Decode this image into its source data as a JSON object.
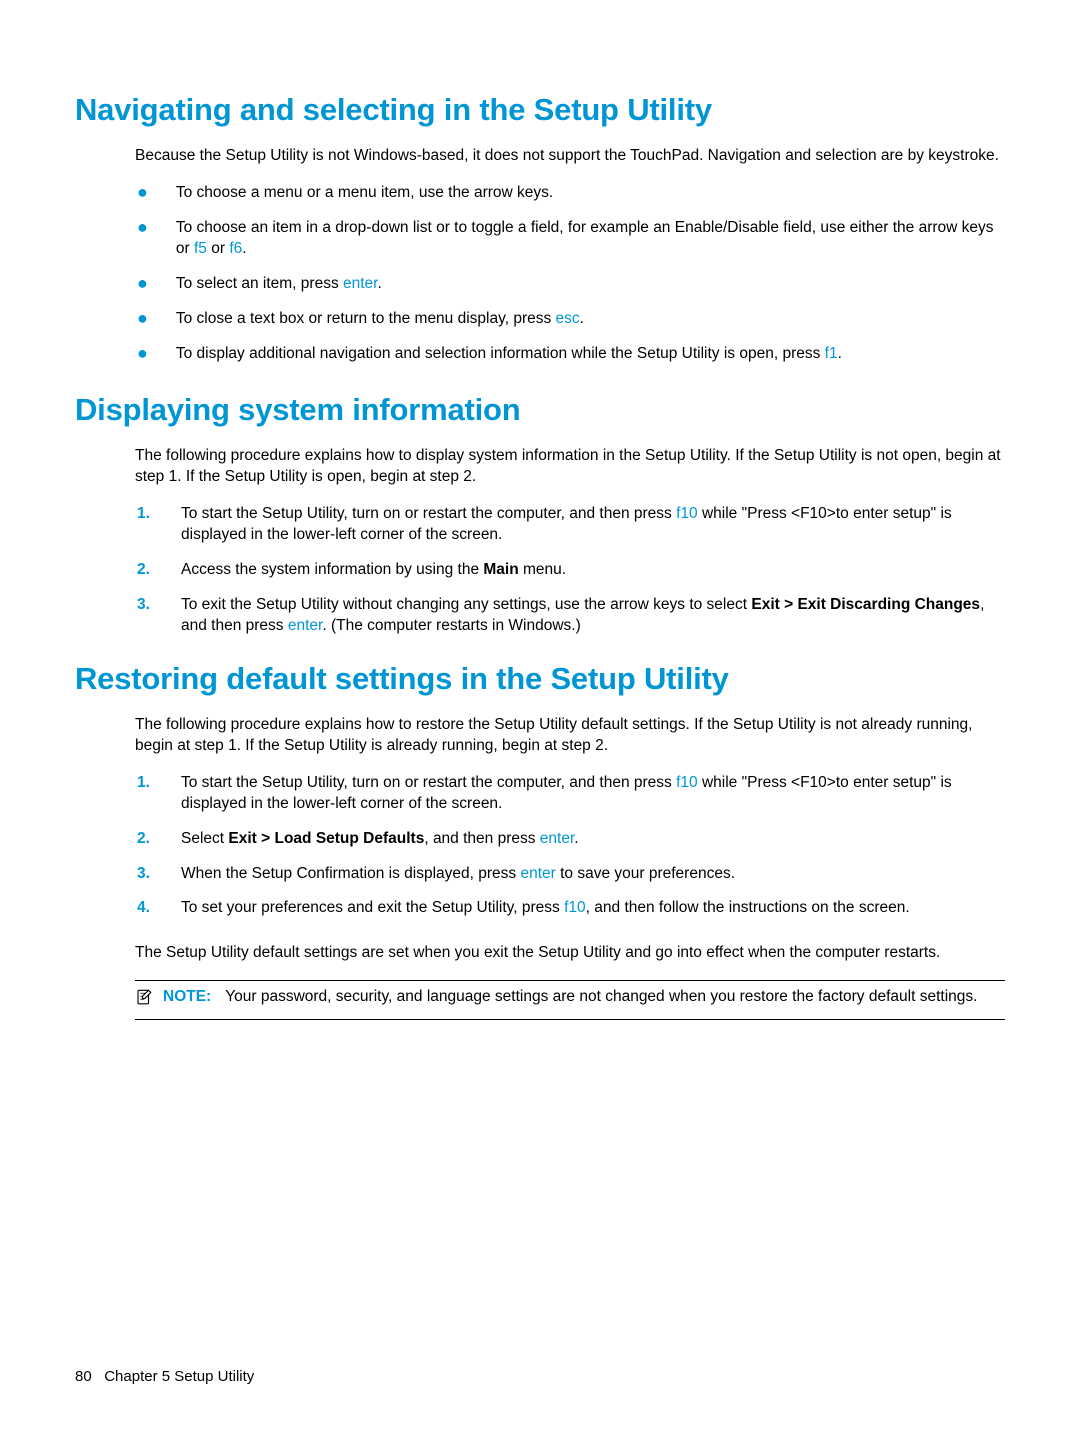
{
  "section1": {
    "heading": "Navigating and selecting in the Setup Utility",
    "intro": "Because the Setup Utility is not Windows-based, it does not support the TouchPad. Navigation and selection are by keystroke.",
    "bullets": {
      "b1": "To choose a menu or a menu item, use the arrow keys.",
      "b2_pre": "To choose an item in a drop-down list or to toggle a field, for example an Enable/Disable field, use either the arrow keys or ",
      "b2_k1": "f5",
      "b2_mid": " or ",
      "b2_k2": "f6",
      "b2_post": ".",
      "b3_pre": "To select an item, press ",
      "b3_k": "enter",
      "b3_post": ".",
      "b4_pre": "To close a text box or return to the menu display, press ",
      "b4_k": "esc",
      "b4_post": ".",
      "b5_pre": "To display additional navigation and selection information while the Setup Utility is open, press ",
      "b5_k": "f1",
      "b5_post": "."
    }
  },
  "section2": {
    "heading": "Displaying system information",
    "intro": "The following procedure explains how to display system information in the Setup Utility. If the Setup Utility is not open, begin at step 1. If the Setup Utility is open, begin at step 2.",
    "steps": {
      "n1": "1.",
      "s1_pre": "To start the Setup Utility, turn on or restart the computer, and then press ",
      "s1_k": "f10",
      "s1_post": " while \"Press <F10>to enter setup\" is displayed in the lower-left corner of the screen.",
      "n2": "2.",
      "s2_pre": "Access the system information by using the ",
      "s2_bold": "Main",
      "s2_post": " menu.",
      "n3": "3.",
      "s3_pre": "To exit the Setup Utility without changing any settings, use the arrow keys to select ",
      "s3_bold": "Exit > Exit Discarding Changes",
      "s3_mid": ", and then press ",
      "s3_k": "enter",
      "s3_post": ". (The computer restarts in Windows.)"
    }
  },
  "section3": {
    "heading": "Restoring default settings in the Setup Utility",
    "intro": "The following procedure explains how to restore the Setup Utility default settings. If the Setup Utility is not already running, begin at step 1. If the Setup Utility is already running, begin at step 2.",
    "steps": {
      "n1": "1.",
      "s1_pre": "To start the Setup Utility, turn on or restart the computer, and then press ",
      "s1_k": "f10",
      "s1_post": " while \"Press <F10>to enter setup\" is displayed in the lower-left corner of the screen.",
      "n2": "2.",
      "s2_pre": "Select ",
      "s2_bold": "Exit > Load Setup Defaults",
      "s2_mid": ", and then press ",
      "s2_k": "enter",
      "s2_post": ".",
      "n3": "3.",
      "s3_pre": "When the Setup Confirmation is displayed, press ",
      "s3_k": "enter",
      "s3_post": " to save your preferences.",
      "n4": "4.",
      "s4_pre": "To set your preferences and exit the Setup Utility, press ",
      "s4_k": "f10",
      "s4_post": ", and then follow the instructions on the screen."
    },
    "outro": "The Setup Utility default settings are set when you exit the Setup Utility and go into effect when the computer restarts.",
    "note": {
      "label": "NOTE:",
      "text": "Your password, security, and language settings are not changed when you restore the factory default settings."
    }
  },
  "footer": {
    "page": "80",
    "chapter": "Chapter 5   Setup Utility"
  }
}
